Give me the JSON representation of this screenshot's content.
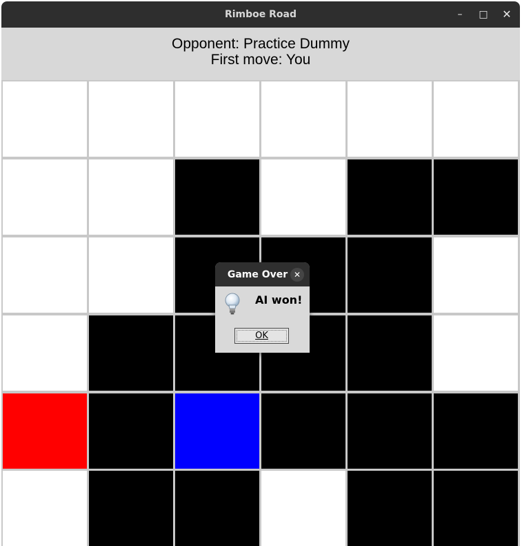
{
  "window": {
    "title": "Rimboe Road",
    "controls": {
      "minimize": "–",
      "maximize": "□",
      "close": "✕"
    }
  },
  "header": {
    "opponent": "Opponent: Practice Dummy",
    "first_move": "First move: You"
  },
  "board": {
    "rows": 6,
    "cols": 6,
    "cells": [
      [
        "white",
        "white",
        "white",
        "white",
        "white",
        "white"
      ],
      [
        "white",
        "white",
        "black",
        "white",
        "black",
        "black"
      ],
      [
        "white",
        "white",
        "black",
        "black",
        "black",
        "white"
      ],
      [
        "white",
        "black",
        "black",
        "black",
        "black",
        "white"
      ],
      [
        "red",
        "black",
        "blue",
        "black",
        "black",
        "black"
      ],
      [
        "white",
        "black",
        "black",
        "white",
        "black",
        "black"
      ]
    ],
    "colors": {
      "white": "#ffffff",
      "black": "#000000",
      "red": "#ff0000",
      "blue": "#0000ff"
    }
  },
  "dialog": {
    "title": "Game Over",
    "close": "✕",
    "icon": "lightbulb-icon",
    "message": "AI won!",
    "ok_label": "OK"
  }
}
